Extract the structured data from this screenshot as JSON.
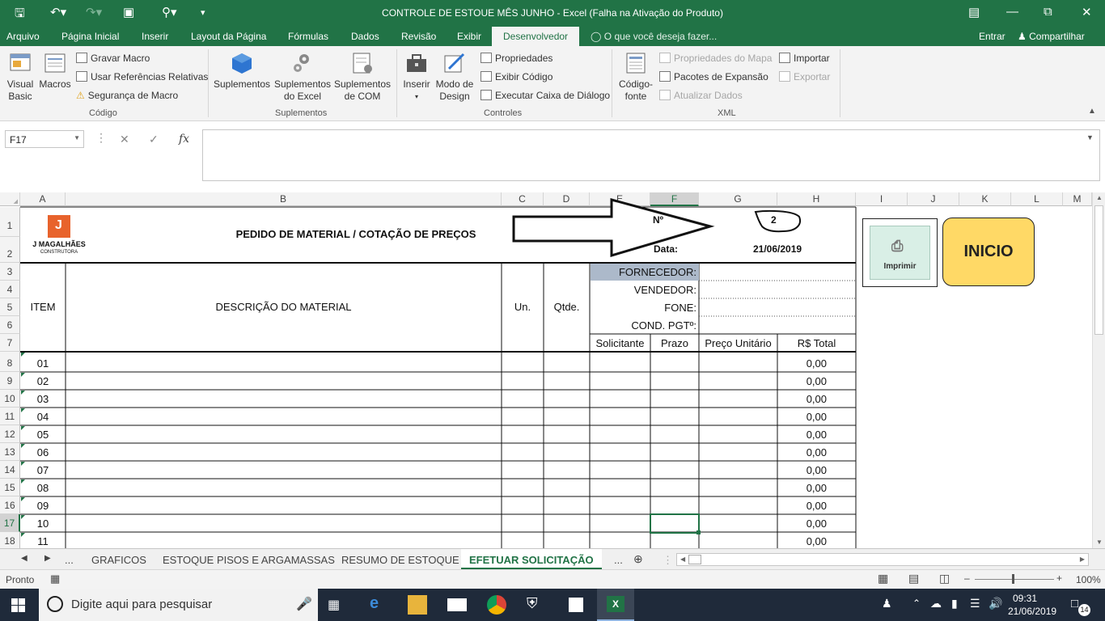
{
  "window": {
    "title": "CONTROLE DE ESTOUE MÊS JUNHO - Excel (Falha na Ativação do Produto)"
  },
  "menu": {
    "file": "Arquivo",
    "tabs": [
      "Página Inicial",
      "Inserir",
      "Layout da Página",
      "Fórmulas",
      "Dados",
      "Revisão",
      "Exibir",
      "Desenvolvedor"
    ],
    "tell_me": "O que você deseja fazer...",
    "sign_in": "Entrar",
    "share": "Compartilhar"
  },
  "ribbon": {
    "codigo": {
      "visual_basic": "Visual Basic",
      "macros": "Macros",
      "gravar_macro": "Gravar Macro",
      "usar_referencias": "Usar Referências Relativas",
      "seguranca": "Segurança de Macro",
      "group": "Código"
    },
    "suplementos": {
      "suplementos": "Suplementos",
      "excel": "Suplementos do Excel",
      "com": "Suplementos de COM",
      "group": "Suplementos"
    },
    "controles": {
      "inserir": "Inserir",
      "modo_design": "Modo de Design",
      "propriedades": "Propriedades",
      "exibir_codigo": "Exibir Código",
      "executar_caixa": "Executar Caixa de Diálogo",
      "group": "Controles"
    },
    "xml": {
      "codigo_fonte": "Código-fonte",
      "propriedades_mapa": "Propriedades do Mapa",
      "pacotes": "Pacotes de Expansão",
      "atualizar": "Atualizar Dados",
      "importar": "Importar",
      "exportar": "Exportar",
      "group": "XML"
    }
  },
  "formula_bar": {
    "name_box": "F17",
    "formula": ""
  },
  "columns": [
    "A",
    "B",
    "C",
    "D",
    "E",
    "F",
    "G",
    "H",
    "I",
    "J",
    "K",
    "L",
    "M"
  ],
  "rows": [
    "1",
    "2",
    "3",
    "4",
    "5",
    "6",
    "7",
    "8",
    "9",
    "10",
    "11",
    "12",
    "13",
    "14",
    "15",
    "16",
    "17",
    "18"
  ],
  "sheet": {
    "logo_line1": "J MAGALHÃES",
    "logo_line2": "CONSTRUTORA",
    "title": "PEDIDO DE MATERIAL / COTAÇÃO DE PREÇOS",
    "numero_label": "Nº",
    "numero_value": "2",
    "data_label": "Data:",
    "data_value": "21/06/2019",
    "fornecedor": "FORNECEDOR:",
    "vendedor": "VENDEDOR:",
    "fone": "FONE:",
    "cond_pgto": "COND. PGTº:",
    "col_item": "ITEM",
    "col_descricao": "DESCRIÇÃO DO MATERIAL",
    "col_un": "Un.",
    "col_qtde": "Qtde.",
    "col_solicitante": "Solicitante",
    "col_prazo": "Prazo",
    "col_preco": "Preço Unitário",
    "col_total": "R$ Total",
    "items": [
      {
        "item": "01",
        "total": "0,00"
      },
      {
        "item": "02",
        "total": "0,00"
      },
      {
        "item": "03",
        "total": "0,00"
      },
      {
        "item": "04",
        "total": "0,00"
      },
      {
        "item": "05",
        "total": "0,00"
      },
      {
        "item": "06",
        "total": "0,00"
      },
      {
        "item": "07",
        "total": "0,00"
      },
      {
        "item": "08",
        "total": "0,00"
      },
      {
        "item": "09",
        "total": "0,00"
      },
      {
        "item": "10",
        "total": "0,00"
      },
      {
        "item": "11",
        "total": "0,00"
      }
    ],
    "btn_imprimir": "Imprimir",
    "btn_inicio": "INICIO"
  },
  "sheet_tabs": [
    "GRAFICOS",
    "ESTOQUE PISOS E ARGAMASSAS",
    "RESUMO DE ESTOQUE",
    "EFETUAR SOLICITAÇÃO"
  ],
  "sheet_tabs_more": "...",
  "status": {
    "ready": "Pronto",
    "zoom": "100%"
  },
  "taskbar": {
    "search_placeholder": "Digite aqui para pesquisar",
    "time": "09:31",
    "date": "21/06/2019",
    "notifications": "14"
  },
  "colors": {
    "excel_green": "#217346",
    "inicio_yellow": "#ffd966",
    "imprimir_green": "#d9efe6",
    "fornecedor_bg": "#acb9ca"
  }
}
